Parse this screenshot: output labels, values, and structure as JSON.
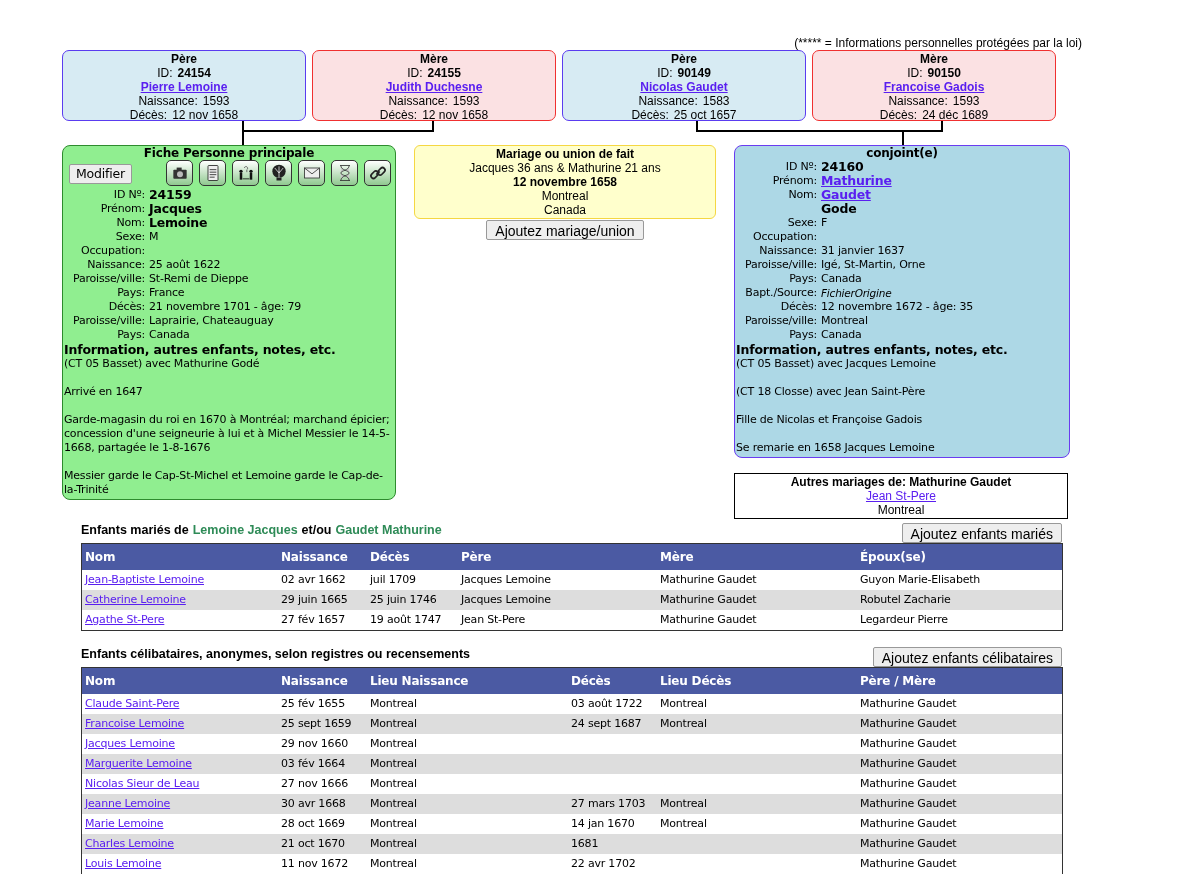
{
  "legal_note": "(***** = Informations personnelles protégées par la loi)",
  "parents": [
    {
      "kind": "father",
      "role": "Père",
      "id_label": "ID:",
      "id": "24154",
      "name": "Pierre Lemoine",
      "birth_label": "Naissance:",
      "birth": "1593",
      "death_label": "Décès:",
      "death": "12 nov 1658"
    },
    {
      "kind": "mother",
      "role": "Mère",
      "id_label": "ID:",
      "id": "24155",
      "name": "Judith Duchesne",
      "birth_label": "Naissance:",
      "birth": "1593",
      "death_label": "Décès:",
      "death": "12 nov 1658"
    },
    {
      "kind": "father",
      "role": "Père",
      "id_label": "ID:",
      "id": "90149",
      "name": "Nicolas Gaudet",
      "birth_label": "Naissance:",
      "birth": "1583",
      "death_label": "Décès:",
      "death": "25 oct 1657"
    },
    {
      "kind": "mother",
      "role": "Mère",
      "id_label": "ID:",
      "id": "90150",
      "name": "Francoise Gadois",
      "birth_label": "Naissance:",
      "birth": "1593",
      "death_label": "Décès:",
      "death": "24 déc 1689"
    }
  ],
  "main_person": {
    "title": "Fiche Personne principale",
    "edit_button": "Modifier",
    "fields": [
      {
        "label": "ID Nº:",
        "value": "24159",
        "kind": "bold"
      },
      {
        "label": "Prénom:",
        "value": "Jacques",
        "kind": "bold"
      },
      {
        "label": "Nom:",
        "value": "Lemoine",
        "kind": "bold"
      },
      {
        "label": "Sexe:",
        "value": "M",
        "kind": "plain"
      },
      {
        "label": "Occupation:"
      },
      {
        "label": "Naissance:",
        "value": "25 août 1622",
        "kind": "plain"
      },
      {
        "label": "Paroisse/ville:",
        "value": "St-Remi de Dieppe",
        "kind": "plain"
      },
      {
        "label": "Pays:",
        "value": "France",
        "kind": "plain"
      },
      {
        "label": "Décès:",
        "value": "21 novembre 1701 - âge: 79",
        "kind": "plain"
      },
      {
        "label": "Paroisse/ville:",
        "value": "Laprairie, Chateauguay",
        "kind": "plain"
      },
      {
        "label": "Pays:",
        "value": "Canada",
        "kind": "plain"
      }
    ],
    "notes_heading": "Information, autres enfants, notes, etc.",
    "notes": [
      "(CT 05 Basset) avec Mathurine Godé",
      "Arrivé en 1647",
      "Garde-magasin du roi en 1670 à Montréal; marchand épicier; concession d'une seigneurie à lui et à Michel Messier le 14-5-1668, partagée le 1-8-1676",
      "Messier garde le Cap-St-Michel et Lemoine garde le Cap-de-la-Trinité"
    ]
  },
  "marriage": {
    "title": "Mariage ou union de fait",
    "ages": "Jacques 36 ans & Mathurine 21 ans",
    "date": "12 novembre 1658",
    "place": "Montreal",
    "country": "Canada",
    "add_button": "Ajoutez mariage/union"
  },
  "spouse": {
    "title": "conjoint(e)",
    "fields": [
      {
        "label": "ID Nº:",
        "value": "24160",
        "kind": "bold"
      },
      {
        "label": "Prénom:",
        "value": "Mathurine",
        "kind": "link"
      },
      {
        "label": "Nom:",
        "value": "Gaudet",
        "kind": "link"
      },
      {
        "value": "Gode",
        "kind": "bold"
      },
      {
        "label": "Sexe:",
        "value": "F",
        "kind": "plain"
      },
      {
        "label": "Occupation:"
      },
      {
        "label": "Naissance:",
        "value": "31 janvier 1637",
        "kind": "plain"
      },
      {
        "label": "Paroisse/ville:",
        "value": "Igé, St-Martin, Orne",
        "kind": "plain"
      },
      {
        "label": "Pays:",
        "value": "Canada",
        "kind": "plain"
      },
      {
        "label": "Bapt./Source:",
        "value": "FichierOrigine",
        "kind": "italic"
      },
      {
        "label": "Décès:",
        "value": "12 novembre 1672 - âge: 35",
        "kind": "plain"
      },
      {
        "label": "Paroisse/ville:",
        "value": "Montreal",
        "kind": "plain"
      },
      {
        "label": "Pays:",
        "value": "Canada",
        "kind": "plain"
      }
    ],
    "notes_heading": "Information, autres enfants, notes, etc.",
    "notes": [
      "(CT 05 Basset) avec Jacques Lemoine",
      "(CT 18 Closse) avec Jean Saint-Père",
      "Fille de Nicolas et Françoise Gadois",
      "Se remarie en 1658 Jacques Lemoine"
    ]
  },
  "other_marriages": {
    "title": "Autres mariages de: Mathurine Gaudet",
    "spouse": "Jean St-Pere",
    "place": "Montreal"
  },
  "married_children": {
    "title_prefix": "Enfants mariés de",
    "name_1": "Lemoine Jacques",
    "title_middle": "et/ou",
    "name_2": "Gaudet Mathurine",
    "add_button": "Ajoutez enfants mariés",
    "columns": [
      "Nom",
      "Naissance",
      "Décès",
      "Père",
      "Mère",
      "Époux(se)"
    ],
    "rows": [
      [
        "Jean-Baptiste Lemoine",
        "02 avr 1662",
        "juil 1709",
        "Jacques Lemoine",
        "Mathurine Gaudet",
        "Guyon Marie-Elisabeth"
      ],
      [
        "Catherine Lemoine",
        "29 juin 1665",
        "25 juin 1746",
        "Jacques Lemoine",
        "Mathurine Gaudet",
        "Robutel Zacharie"
      ],
      [
        "Agathe St-Pere",
        "27 fév 1657",
        "19 août 1747",
        "Jean St-Pere",
        "Mathurine Gaudet",
        "Legardeur Pierre"
      ]
    ]
  },
  "single_children": {
    "title": "Enfants célibataires, anonymes, selon registres ou recensements",
    "add_button": "Ajoutez enfants célibataires",
    "columns": [
      "Nom",
      "Naissance",
      "Lieu Naissance",
      "Décès",
      "Lieu Décès",
      "Père / Mère"
    ],
    "rows": [
      [
        "Claude Saint-Pere",
        "25 fév 1655",
        "Montreal",
        "03 août 1722",
        "Montreal",
        "Mathurine Gaudet"
      ],
      [
        "Francoise Lemoine",
        "25 sept 1659",
        "Montreal",
        "24 sept 1687",
        "Montreal",
        "Mathurine Gaudet"
      ],
      [
        "Jacques Lemoine",
        "29 nov 1660",
        "Montreal",
        "",
        "",
        "Mathurine Gaudet"
      ],
      [
        "Marguerite Lemoine",
        "03 fév 1664",
        "Montreal",
        "",
        "",
        "Mathurine Gaudet"
      ],
      [
        "Nicolas Sieur de Leau",
        "27 nov 1666",
        "Montreal",
        "",
        "",
        "Mathurine Gaudet"
      ],
      [
        "Jeanne Lemoine",
        "30 avr 1668",
        "Montreal",
        "27 mars 1703",
        "Montreal",
        "Mathurine Gaudet"
      ],
      [
        "Marie Lemoine",
        "28 oct 1669",
        "Montreal",
        "14 jan 1670",
        "Montreal",
        "Mathurine Gaudet"
      ],
      [
        "Charles Lemoine",
        "21 oct 1670",
        "Montreal",
        "1681",
        "",
        "Mathurine Gaudet"
      ],
      [
        "Louis Lemoine",
        "11 nov 1672",
        "Montreal",
        "22 avr 1702",
        "",
        "Mathurine Gaudet"
      ]
    ]
  }
}
